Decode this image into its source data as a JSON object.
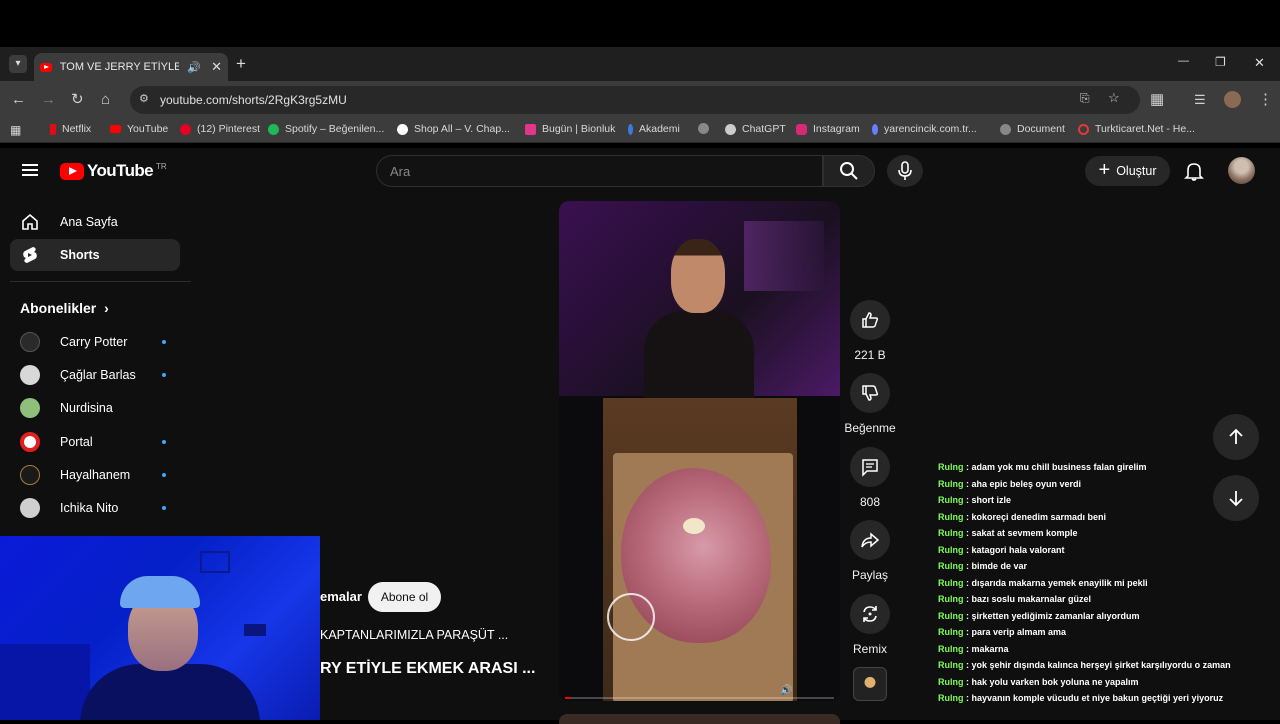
{
  "browser": {
    "tab_title": "TOM VE JERRY ETİYLE EKMEK",
    "tab_close": "✕",
    "new_tab": "+",
    "url": "youtube.com/shorts/2RgK3rg5zMU",
    "window_controls": {
      "minimize": "—",
      "restore": "❐",
      "close": "✕"
    },
    "bookmarks": [
      {
        "label": "Netflix",
        "color": "#e50914"
      },
      {
        "label": "YouTube",
        "color": "#ff0000"
      },
      {
        "label": "(12) Pinterest",
        "color": "#e60023"
      },
      {
        "label": "Spotify – Beğenilen...",
        "color": "#1db954"
      },
      {
        "label": "Shop All – V. Chap...",
        "color": "#ffffff"
      },
      {
        "label": "Bugün | Bionluk",
        "color": "#e2368c"
      },
      {
        "label": "Akademi",
        "color": "#3b7ddd"
      },
      {
        "label": "",
        "color": "#888888"
      },
      {
        "label": "ChatGPT",
        "color": "#cccccc"
      },
      {
        "label": "Instagram",
        "color": "#d62976"
      },
      {
        "label": "yarencincik.com.tr...",
        "color": "#6b7cff"
      },
      {
        "label": "Document",
        "color": "#888888"
      },
      {
        "label": "Turkticaret.Net - He...",
        "color": "#e03a3a"
      }
    ]
  },
  "youtube": {
    "logo_text": "YouTube",
    "region": "TR",
    "search_placeholder": "Ara",
    "create_label": "Oluştur",
    "nav": [
      {
        "label": "Ana Sayfa"
      },
      {
        "label": "Shorts"
      }
    ],
    "subscriptions_header": "Abonelikler",
    "subscriptions": [
      {
        "label": "Carry Potter",
        "color": "#2a2a2a",
        "new": true
      },
      {
        "label": "Çağlar Barlas",
        "color": "#d8d8d8",
        "new": true
      },
      {
        "label": "Nurdisina",
        "color": "#8fbf7a",
        "new": false
      },
      {
        "label": "Portal",
        "color": "#e02020",
        "new": true
      },
      {
        "label": "Hayalhanem",
        "color": "#1a1a1a",
        "new": true
      },
      {
        "label": "Ichika Nito",
        "color": "#cfcfcf",
        "new": true
      }
    ],
    "short": {
      "channel_partial": "emalar",
      "subscribe_label": "Abone ol",
      "subtitle_partial": "KAPTANLARIMIZLA PARAŞÜT ...",
      "title_partial": "RY ETİYLE EKMEK ARASI ...",
      "progress": 0.02
    },
    "actions": {
      "likes": "221 B",
      "dislike_label": "Beğenme",
      "comments": "808",
      "share_label": "Paylaş",
      "remix_label": "Remix"
    }
  },
  "chat": {
    "messages": [
      {
        "user": "Rulng",
        "text": ": adam yok mu chill business falan girelim"
      },
      {
        "user": "Rulng",
        "text": ": aha epic beleş oyun verdi"
      },
      {
        "user": "Rulng",
        "text": ": short izle"
      },
      {
        "user": "Rulng",
        "text": ": kokoreçi denedim sarmadı beni"
      },
      {
        "user": "Rulng",
        "text": ": sakat at sevmem komple"
      },
      {
        "user": "Rulng",
        "text": ": katagori hala valorant"
      },
      {
        "user": "Rulng",
        "text": ": bimde de var"
      },
      {
        "user": "Rulng",
        "text": ": dışarıda makarna yemek enayilik mi pekli"
      },
      {
        "user": "Rulng",
        "text": ": bazı soslu makarnalar güzel"
      },
      {
        "user": "Rulng",
        "text": ": şirketten yediğimiz zamanlar alıyordum"
      },
      {
        "user": "Rulng",
        "text": ": para verip almam ama"
      },
      {
        "user": "Rulng",
        "text": ": makarna"
      },
      {
        "user": "Rulng",
        "text": ": yok şehir dışında kalınca herşeyi şirket karşılıyordu o zaman"
      },
      {
        "user": "Rulng",
        "text": ": hak yolu varken bok yoluna ne yapalım"
      },
      {
        "user": "Rulng",
        "text": ": hayvanın komple vücudu et niye bakun geçtiği yeri yiyoruz"
      }
    ]
  }
}
